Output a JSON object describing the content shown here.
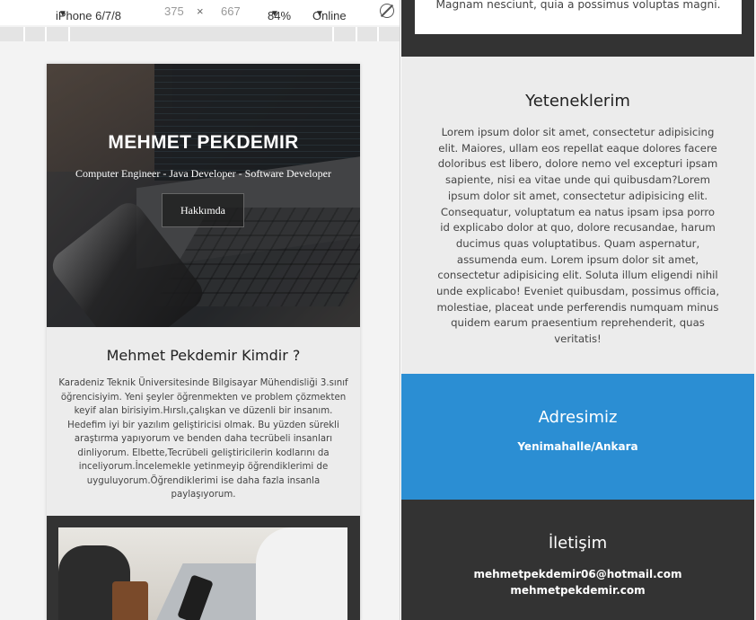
{
  "devtools": {
    "device": "iPhone 6/7/8",
    "width": "375",
    "times": "×",
    "height": "667",
    "zoom": "84%",
    "network": "Online",
    "caret": "▼"
  },
  "hero": {
    "title": "MEHMET PEKDEMIR",
    "subtitle": "Computer Engineer - Java Developer - Software Developer",
    "button_label": "Hakkımda"
  },
  "about": {
    "title": "Mehmet Pekdemir Kimdir ?",
    "text": "Karadeniz Teknik Üniversitesinde Bilgisayar Mühendisliği 3.sınıf öğrencisiyim. Yeni şeyler öğrenmekten ve problem çözmekten keyif alan birisiyim.Hırslı,çalışkan ve düzenli bir insanım. Hedefim iyi bir yazılım geliştiricisi olmak. Bu yüzden sürekli araştırma yapıyorum ve benden daha tecrübeli insanları dinliyorum. Elbette,Tecrübeli geliştiricilerin kodlarını da inceliyorum.İncelemekle yetinmeyip öğrendiklerimi de uyguluyorum.Öğrendiklerimi ise daha fazla insanla paylaşıyorum."
  },
  "top_card": {
    "text": "Magnam nesciunt, quia a possimus voluptas magni."
  },
  "skills": {
    "title": "Yeteneklerim",
    "text": "Lorem ipsum dolor sit amet, consectetur adipisicing elit. Maiores, ullam eos repellat eaque dolores facere doloribus est libero, dolore nemo vel excepturi ipsam sapiente, nisi ea vitae unde qui quibusdam?Lorem ipsum dolor sit amet, consectetur adipisicing elit. Consequatur, voluptatum ea natus ipsam ipsa porro id explicabo dolor at quo, dolore recusandae, harum ducimus quas voluptatibus. Quam aspernatur, assumenda eum. Lorem ipsum dolor sit amet, consectetur adipisicing elit. Soluta illum eligendi nihil unde explicabo! Eveniet quibusdam, possimus officia, molestiae, placeat unde perferendis numquam minus quidem earum praesentium reprehenderit, quas veritatis!"
  },
  "address": {
    "title": "Adresimiz",
    "text": "Yenimahalle/Ankara"
  },
  "contact": {
    "title": "İletişim",
    "email1": "mehmetpekdemir06@hotmail.com",
    "email2": "mehmetpekdemir.com"
  },
  "colors": {
    "dark": "#333333",
    "light_section": "#ececec",
    "accent_blue": "#2b8ed3"
  }
}
